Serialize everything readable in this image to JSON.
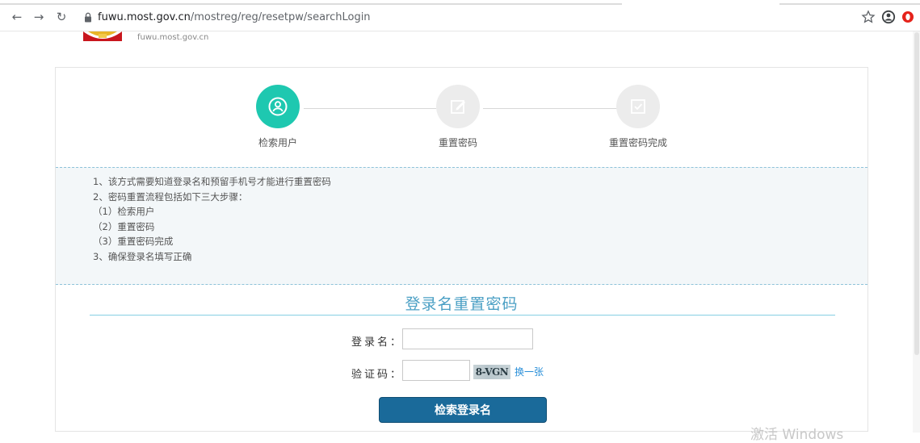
{
  "browser": {
    "url_domain": "fuwu.most.gov.cn",
    "url_path": "/mostreg/reg/resetpw/searchLogin"
  },
  "site": {
    "url_text": "fuwu.most.gov.cn"
  },
  "steps": [
    {
      "label": "检索用户",
      "state": "active",
      "icon": "user-icon"
    },
    {
      "label": "重置密码",
      "state": "inactive",
      "icon": "edit-icon"
    },
    {
      "label": "重置密码完成",
      "state": "inactive",
      "icon": "check-icon"
    }
  ],
  "instructions": [
    "1、该方式需要知道登录名和预留手机号才能进行重置密码",
    "2、密码重置流程包括如下三大步骤：",
    "（1）检索用户",
    "（2）重置密码",
    "（3）重置密码完成",
    "3、确保登录名填写正确"
  ],
  "form": {
    "title": "登录名重置密码",
    "login_label": "登录名：",
    "login_value": "",
    "captcha_label": "验证码：",
    "captcha_value": "",
    "captcha_image_text": "8-VGN",
    "refresh_link": "换一张",
    "submit_label": "检索登录名"
  },
  "watermark": "激活 Windows",
  "colors": {
    "accent_teal": "#1ec8b0",
    "link_blue": "#2a8fd8",
    "title_blue": "#4a9fc4",
    "button_blue": "#1a6a9a"
  }
}
